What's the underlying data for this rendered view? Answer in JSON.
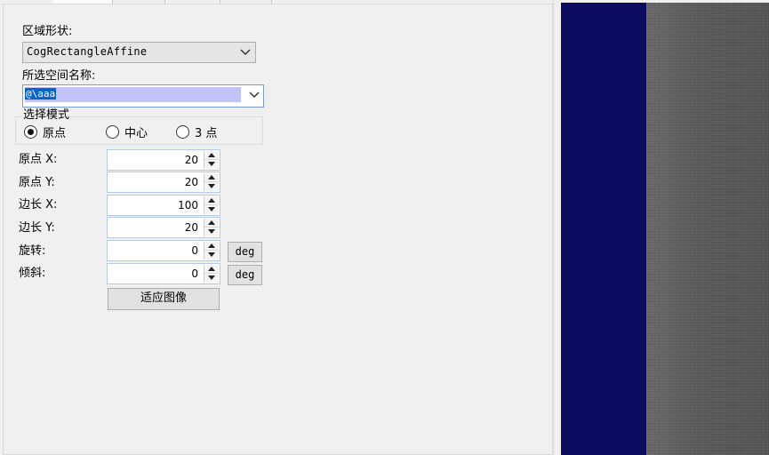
{
  "region_shape": {
    "label": "区域形状:",
    "value": "CogRectangleAffine"
  },
  "space_name": {
    "label": "所选空间名称:",
    "value": "@\\aaa"
  },
  "select_mode": {
    "title": "选择模式",
    "options": [
      {
        "label": "原点",
        "selected": true
      },
      {
        "label": "中心",
        "selected": false
      },
      {
        "label": "3 点",
        "selected": false
      }
    ]
  },
  "fields": [
    {
      "label": "原点 X:",
      "value": "20",
      "unit": ""
    },
    {
      "label": "原点 Y:",
      "value": "20",
      "unit": ""
    },
    {
      "label": "边长 X:",
      "value": "100",
      "unit": ""
    },
    {
      "label": "边长 Y:",
      "value": "20",
      "unit": ""
    },
    {
      "label": "旋转:",
      "value": "0",
      "unit": "deg"
    },
    {
      "label": "倾斜:",
      "value": "0",
      "unit": "deg"
    }
  ],
  "fit_image_button": "适应图像",
  "colors": {
    "image_navy": "#0c0c5e",
    "image_gray": "#5c5c5c",
    "selection": "#0a64c8"
  }
}
